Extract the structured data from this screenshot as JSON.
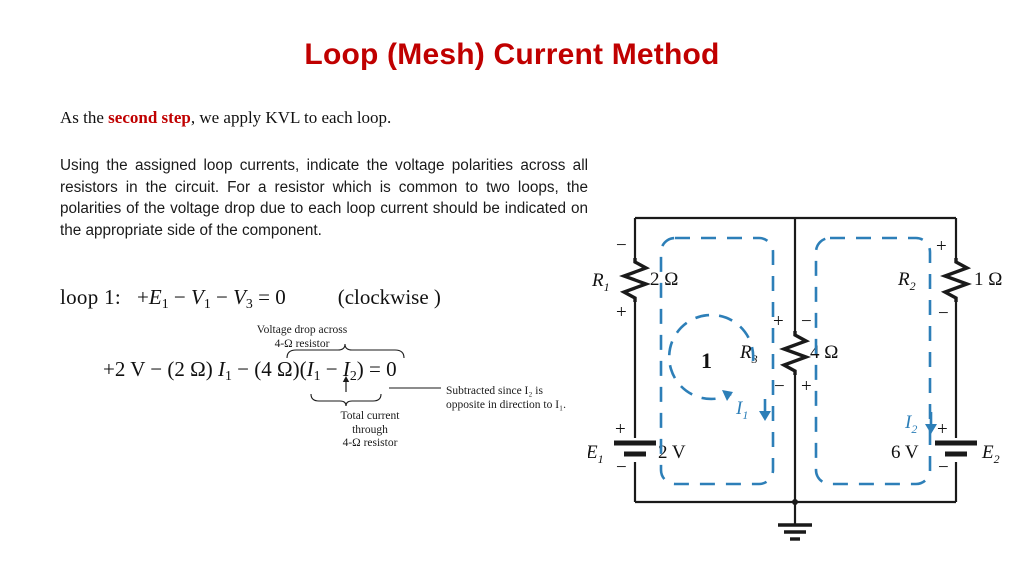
{
  "slide": {
    "title": "Loop (Mesh) Current Method",
    "title_color": "#c00000"
  },
  "intro": {
    "before": "As the ",
    "highlight": "second step",
    "after": ", we apply KVL to each loop."
  },
  "paragraph": {
    "text": "Using the assigned loop currents, indicate the voltage polarities across all resistors in the circuit. For a resistor which is common to two loops, the polarities of the voltage drop due to each loop current should be indicated on the appropriate side of the component."
  },
  "equations": {
    "loop1": {
      "label": "loop 1:",
      "body_plus": "+",
      "e1": "E",
      "e1_sub": "1",
      "minus1": "−",
      "v1": "V",
      "v1_sub": "1",
      "minus2": "−",
      "v3": "V",
      "v3_sub": "3",
      "equals": "= 0",
      "note": "(clockwise )"
    },
    "loop1_expanded": {
      "term1": "+2 V",
      "op1": "−",
      "r1_term": "(2 Ω)",
      "i1": "I",
      "i1_sub": "1",
      "op2": "−",
      "r3_term": "(4 Ω)",
      "paren_open": "(",
      "i1b": "I",
      "i1b_sub": "1",
      "inner_minus": "−",
      "i2": "I",
      "i2_sub": "2",
      "paren_close": ")",
      "equals": "= 0"
    },
    "annotations": {
      "voltage_drop": {
        "line1": "Voltage drop across",
        "line2": "4-Ω resistor"
      },
      "total_current": {
        "line1": "Total current",
        "line2": "through",
        "line3": "4-Ω resistor"
      },
      "subtracted": {
        "line1": "Subtracted since I₂ is",
        "line2": "opposite in direction to I₁."
      }
    }
  },
  "circuit": {
    "loop_color": "#2d7fb8",
    "wire_color": "#1a1a1a",
    "components": {
      "r1": {
        "name": "R",
        "sub": "1",
        "value": "2 Ω",
        "polarity_top": "−",
        "polarity_bottom": "+"
      },
      "r2": {
        "name": "R",
        "sub": "2",
        "value": "1 Ω",
        "polarity_top": "+",
        "polarity_bottom": "−"
      },
      "r3": {
        "name": "R",
        "sub": "3",
        "value": "4 Ω",
        "polarity_top_left": "+",
        "polarity_top_right": "−",
        "polarity_bottom_left": "−",
        "polarity_bottom_right": "+"
      },
      "e1": {
        "name": "E",
        "sub": "1",
        "value": "2 V",
        "polarity_top": "+",
        "polarity_bottom": "−"
      },
      "e2": {
        "name": "E",
        "sub": "2",
        "value": "6 V",
        "polarity_top": "+",
        "polarity_bottom": "−"
      }
    },
    "currents": {
      "i1": {
        "name": "I",
        "sub": "1"
      },
      "i2": {
        "name": "I",
        "sub": "2"
      }
    },
    "loop_label_1": "1"
  }
}
